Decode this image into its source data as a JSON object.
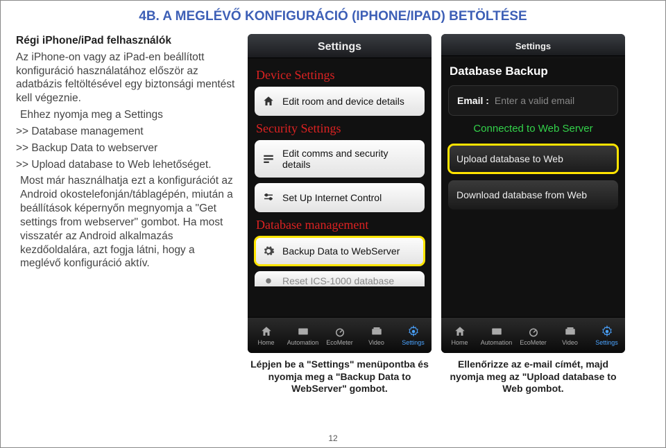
{
  "title": "4B. A MEGLÉVŐ KONFIGURÁCIÓ (IPHONE/IPAD) BETÖLTÉSE",
  "text": {
    "heading_bold": "Régi iPhone/iPad felhasználók",
    "p1a": "Az iPhone-on vagy az iPad-en beállított konfiguráció használatához először az adatbázis feltöltésével egy biztonsági mentést kell végeznie.",
    "p1b": "Ehhez nyomja meg a Settings",
    "p1c": ">> Database management",
    "p1d": ">> Backup Data to webserver",
    "p1e": ">> Upload database to Web lehetőséget.",
    "p2": "Most már használhatja ezt a konfigurációt az Android okostelefonján/táblagépén, miután a beállítások képernyőn megnyomja a \"Get settings from webserver\" gombot. Ha most visszatér az Android alkalmazás kezdőoldalára, azt fogja látni, hogy a meglévő konfiguráció aktív."
  },
  "shot1": {
    "title": "Settings",
    "sec1": "Device Settings",
    "row1": "Edit room and device details",
    "sec2": "Security Settings",
    "row2": "Edit comms and security details",
    "row3": "Set Up Internet Control",
    "sec3": "Database management",
    "row4": "Backup Data to WebServer",
    "row5": "Reset ICS-1000 database",
    "caption": "Lépjen be a \"Settings\" menüpontba és nyomja meg a \"Backup Data to WebServer\" gombot."
  },
  "shot2": {
    "title": "Settings",
    "heading": "Database Backup",
    "email_label": "Email :",
    "email_placeholder": "Enter a valid email",
    "status": "Connected to Web Server",
    "row_upload": "Upload database to Web",
    "row_download": "Download database from Web",
    "caption": "Ellenőrizze az e-mail címét, majd nyomja meg az \"Upload database to Web gombot."
  },
  "tabs": {
    "home": "Home",
    "automation": "Automation",
    "ecometer": "EcoMeter",
    "video": "Video",
    "settings": "Settings"
  },
  "page_number": "12"
}
